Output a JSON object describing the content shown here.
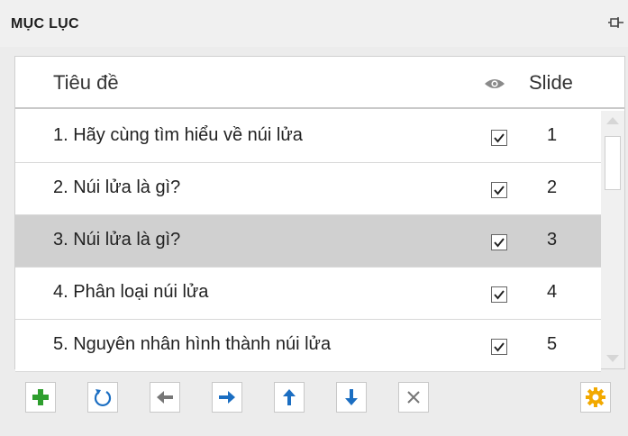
{
  "panel": {
    "title": "MỤC LỤC"
  },
  "list": {
    "header": {
      "title_col": "Tiêu đề",
      "slide_col": "Slide",
      "visibility_icon": "eye-icon"
    },
    "rows": [
      {
        "title": "1. Hãy cùng tìm hiểu về núi lửa",
        "visible": true,
        "slide": "1",
        "selected": false
      },
      {
        "title": "2. Núi lửa là gì?",
        "visible": true,
        "slide": "2",
        "selected": false
      },
      {
        "title": "3. Núi lửa là gì?",
        "visible": true,
        "slide": "3",
        "selected": true
      },
      {
        "title": "4. Phân loại núi lửa",
        "visible": true,
        "slide": "4",
        "selected": false
      },
      {
        "title": "5. Nguyên nhân hình thành núi lửa",
        "visible": true,
        "slide": "5",
        "selected": false
      }
    ]
  },
  "toolbar": {
    "buttons": [
      {
        "icon": "add-icon"
      },
      {
        "icon": "refresh-icon"
      },
      {
        "icon": "arrow-left-icon"
      },
      {
        "icon": "arrow-right-icon"
      },
      {
        "icon": "arrow-up-icon"
      },
      {
        "icon": "arrow-down-icon"
      },
      {
        "icon": "delete-icon"
      },
      {
        "icon": "settings-icon"
      }
    ]
  },
  "colors": {
    "add": "#2e9e2e",
    "blue": "#1b6ec2",
    "gray_icon": "#777777",
    "settings": "#f2a900",
    "selected_row": "#d0d0d0"
  }
}
